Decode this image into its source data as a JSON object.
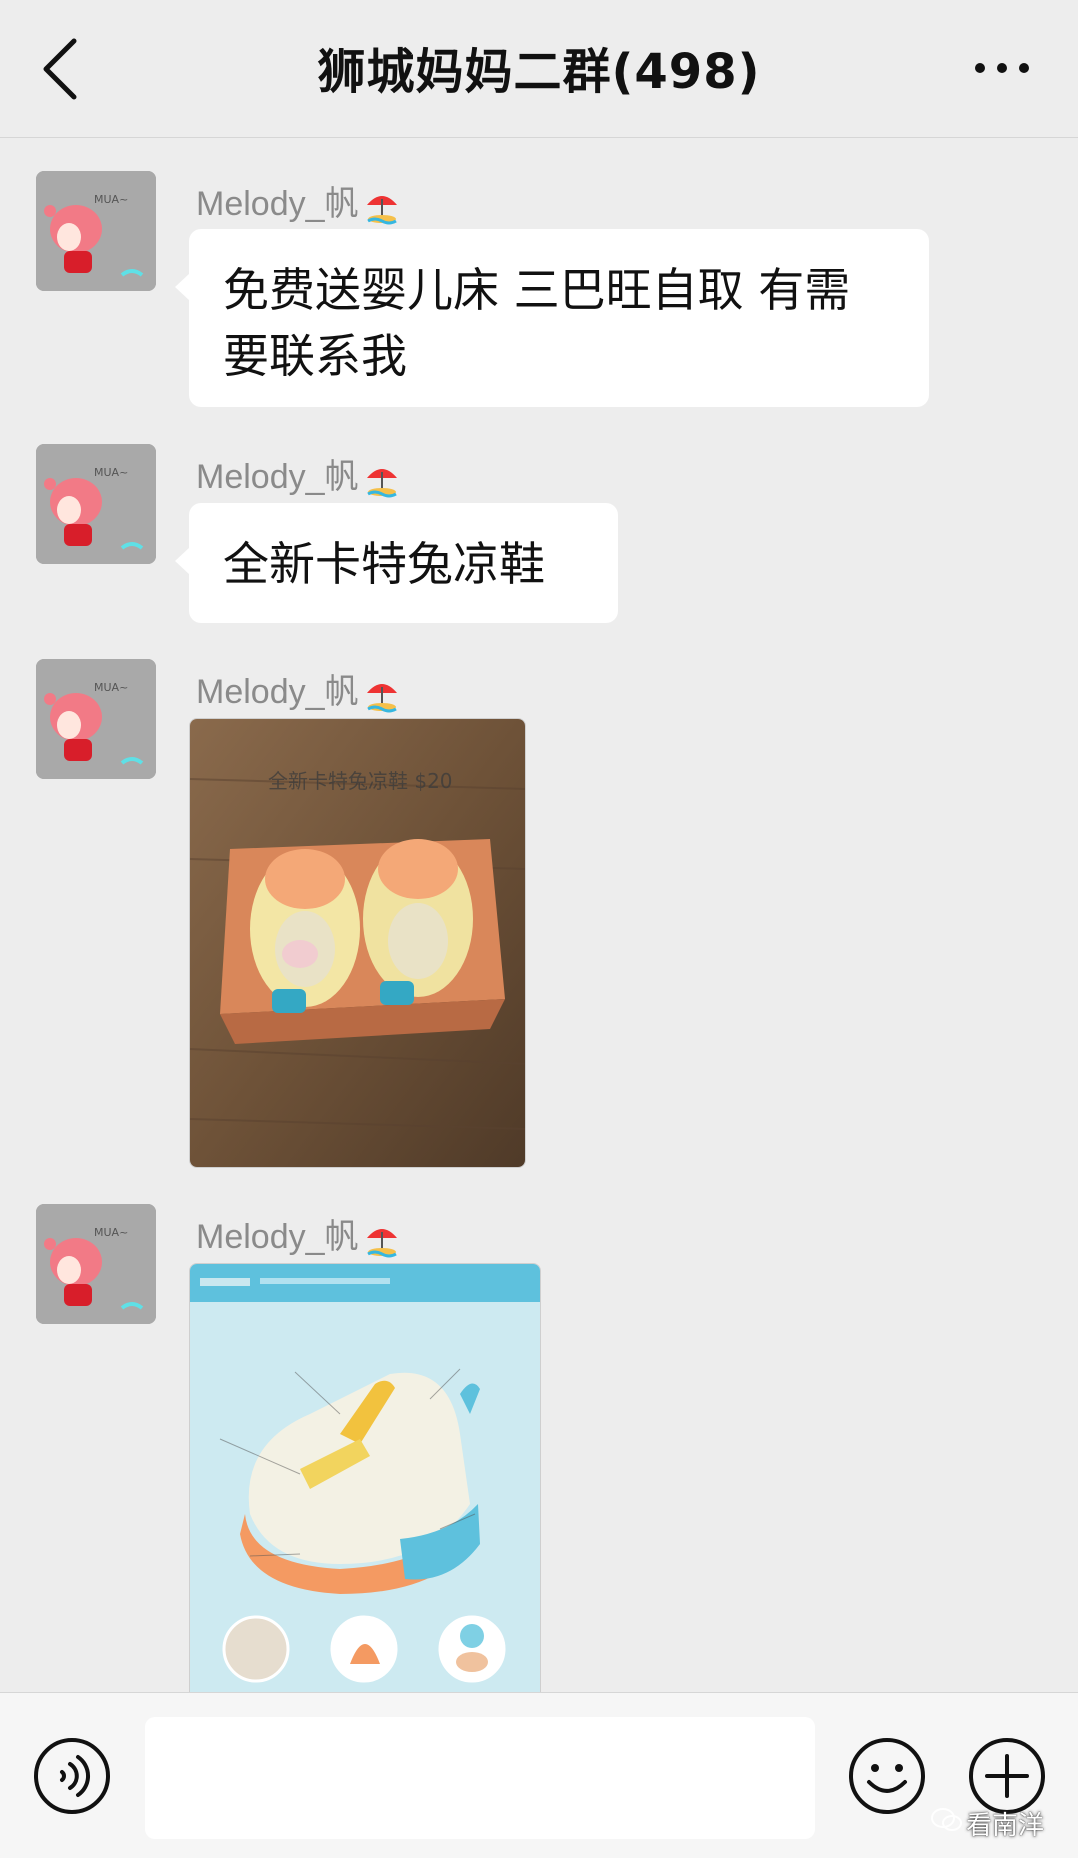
{
  "header": {
    "title": "狮城妈妈二群(498)",
    "back_icon": "chevron-left-icon",
    "more_icon": "more-dots-icon"
  },
  "messages": [
    {
      "type": "text",
      "sender": "Melody_帆",
      "text": "免费送婴儿床 三巴旺自取 有需要联系我"
    },
    {
      "type": "text",
      "sender": "Melody_帆",
      "text": "全新卡特兔凉鞋"
    },
    {
      "type": "image",
      "sender": "Melody_帆",
      "caption": "全新卡特兔凉鞋 $20"
    },
    {
      "type": "image",
      "sender": "Melody_帆"
    }
  ],
  "composer": {
    "voice_icon": "voice-icon",
    "input_value": "",
    "emoji_icon": "smile-icon",
    "plus_icon": "plus-icon"
  },
  "watermark": "看南洋",
  "colors": {
    "background": "#ededed",
    "bubble": "#ffffff",
    "sender_name": "#8a8a8a",
    "composer": "#f6f6f6"
  }
}
